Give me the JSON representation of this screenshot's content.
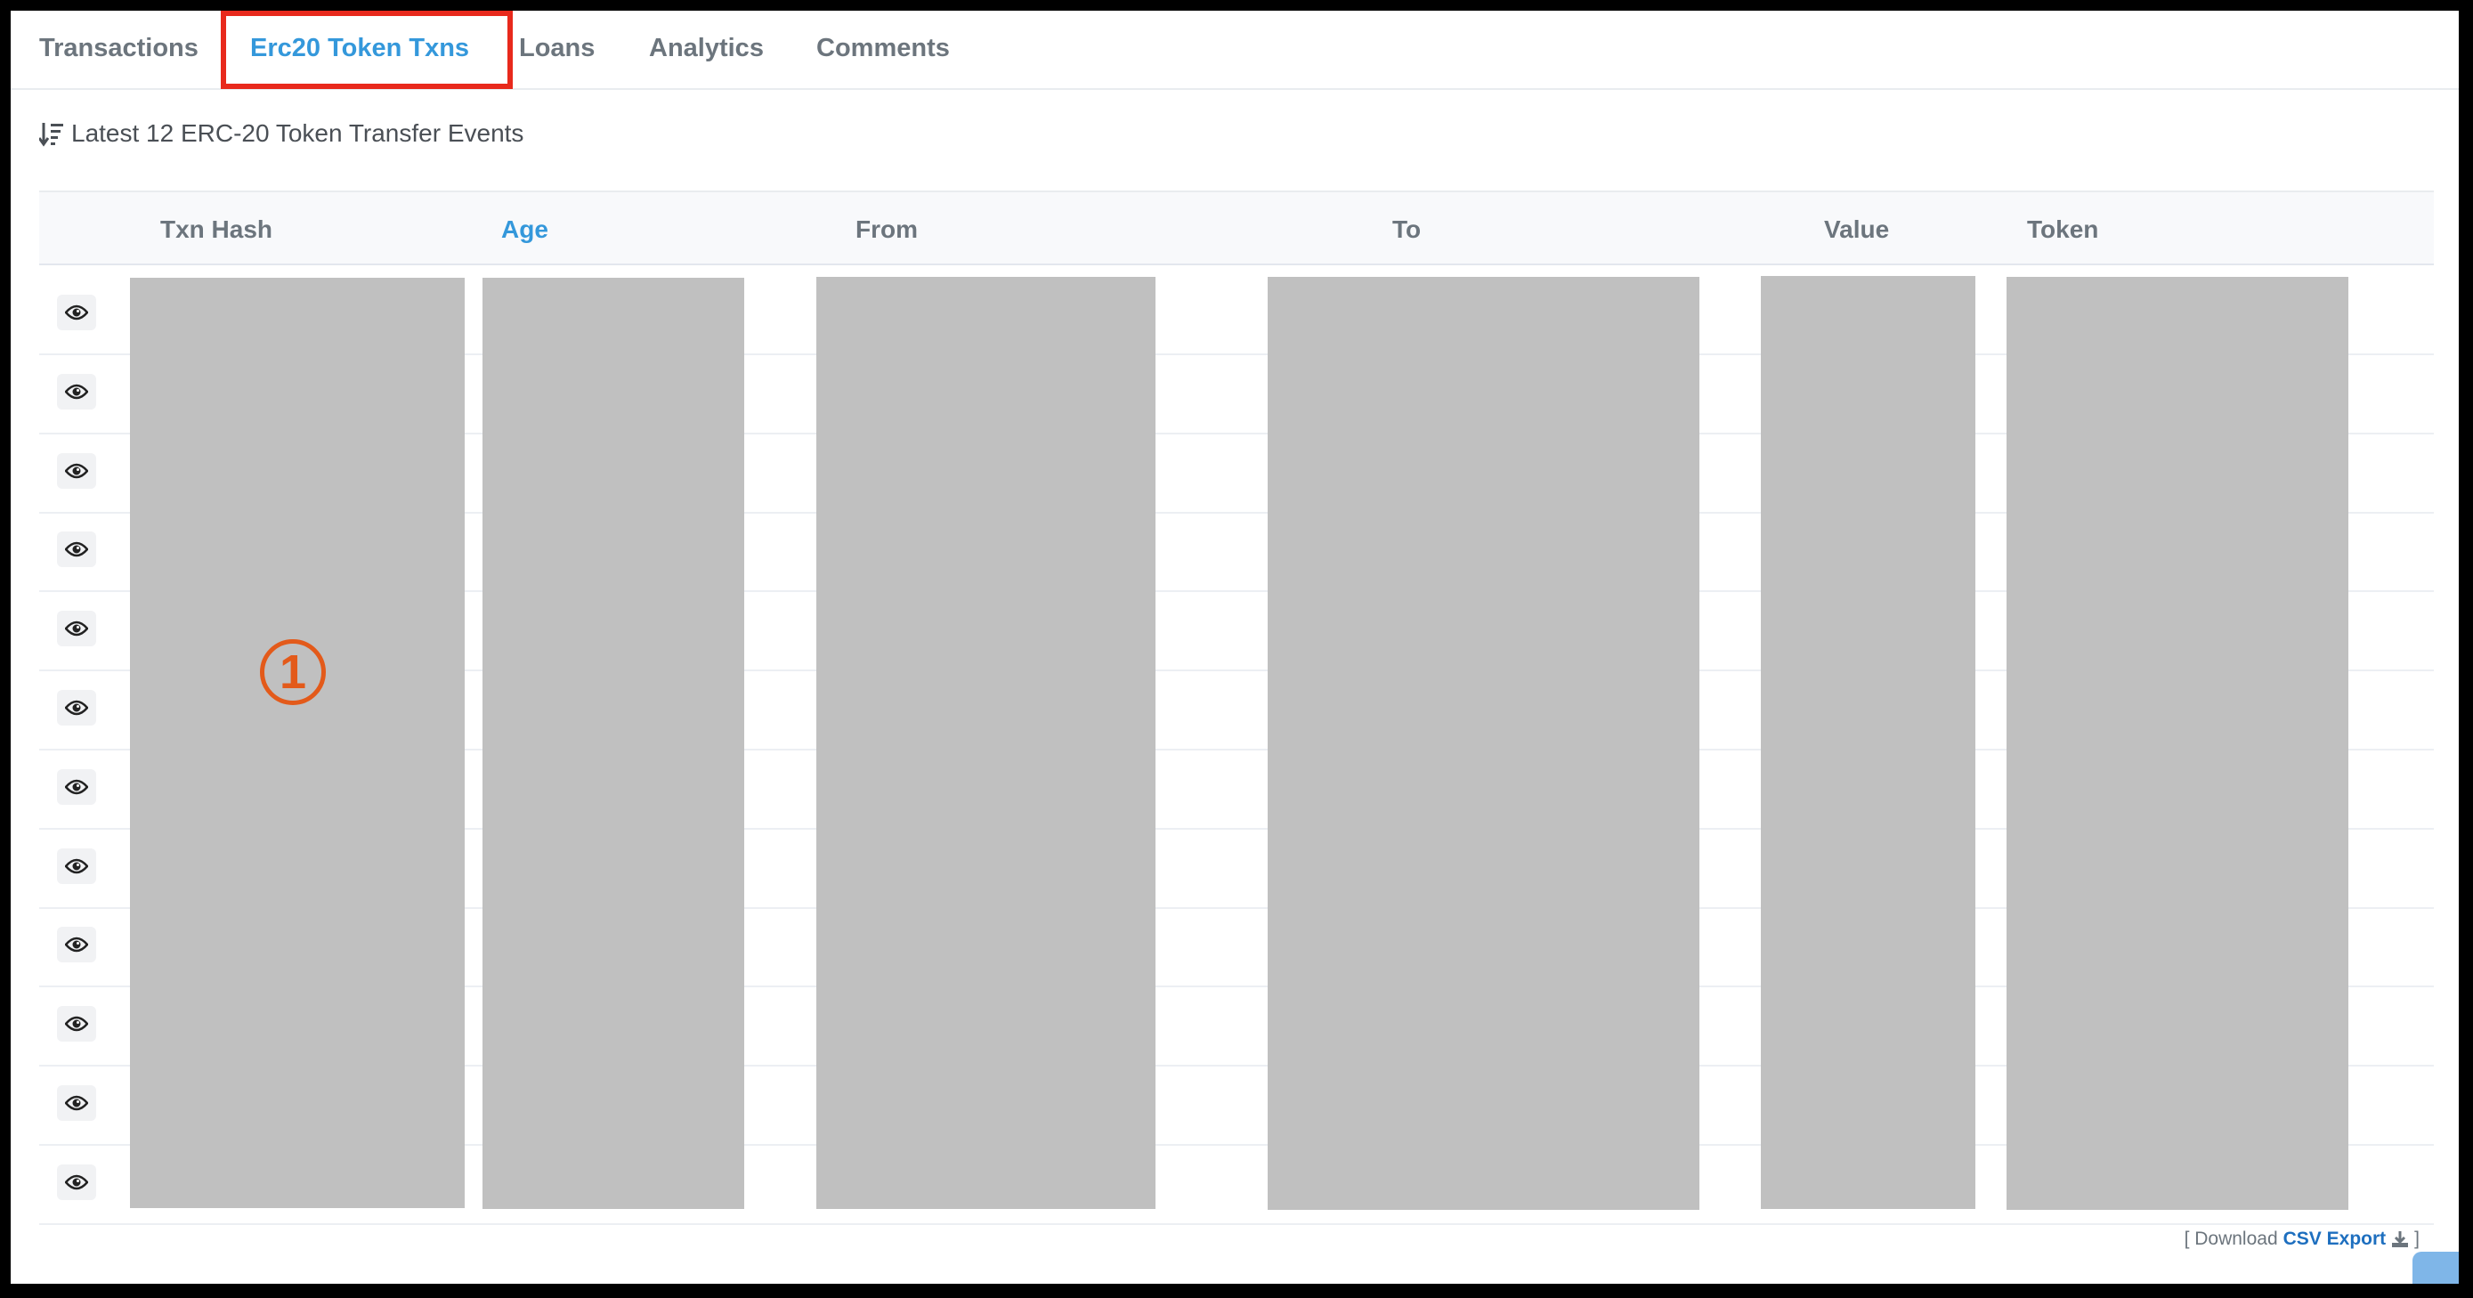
{
  "tabs": [
    {
      "label": "Transactions",
      "active": false
    },
    {
      "label": "Erc20 Token Txns",
      "active": true
    },
    {
      "label": "Loans",
      "active": false
    },
    {
      "label": "Analytics",
      "active": false
    },
    {
      "label": "Comments",
      "active": false
    }
  ],
  "subtitle": "Latest 12 ERC-20 Token Transfer Events",
  "table": {
    "headers": [
      "Txn Hash",
      "Age",
      "From",
      "To",
      "Value",
      "Token"
    ],
    "sorted_column": "Age",
    "row_count": 12
  },
  "annotation": {
    "marker": "1"
  },
  "footer": {
    "prefix": "[ Download",
    "link": "CSV Export",
    "suffix": "]"
  },
  "colors": {
    "accent": "#3498db",
    "highlight_box": "#e8291c",
    "marker": "#e35a1a",
    "redaction": "#c0c0c0"
  }
}
